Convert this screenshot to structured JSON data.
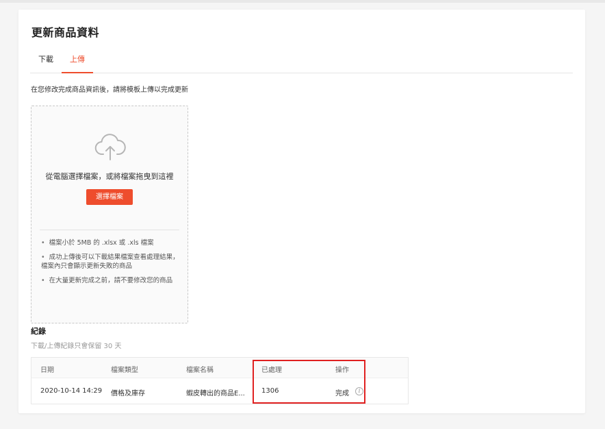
{
  "page": {
    "title": "更新商品資料"
  },
  "tabs": [
    {
      "label": "下載",
      "active": false
    },
    {
      "label": "上傳",
      "active": true
    }
  ],
  "upload": {
    "hint": "在您修改完成商品資訊後，請將模板上傳以完成更新",
    "drop_text": "從電腦選擇檔案，或將檔案拖曳到這裡",
    "select_button": "選擇檔案",
    "icon": "cloud-upload-icon",
    "rules": [
      "檔案小於 5MB 的 .xlsx 或 .xls 檔案",
      "成功上傳後可以下載結果檔案查看處理結果，檔案內只會顯示更新失敗的商品",
      "在大量更新完成之前，請不要修改您的商品"
    ]
  },
  "records": {
    "title": "紀錄",
    "note": "下載/上傳紀錄只會保留 30 天",
    "columns": [
      "日期",
      "檔案類型",
      "檔案名稱",
      "已處理",
      "操作"
    ],
    "rows": [
      {
        "date": "2020-10-14 14:29",
        "type": "價格及庫存",
        "filename": "蝦皮轉出的商品E...",
        "processed": "1306",
        "action": "完成"
      }
    ]
  },
  "colors": {
    "accent": "#ee4d2d",
    "highlight": "#e02020"
  }
}
